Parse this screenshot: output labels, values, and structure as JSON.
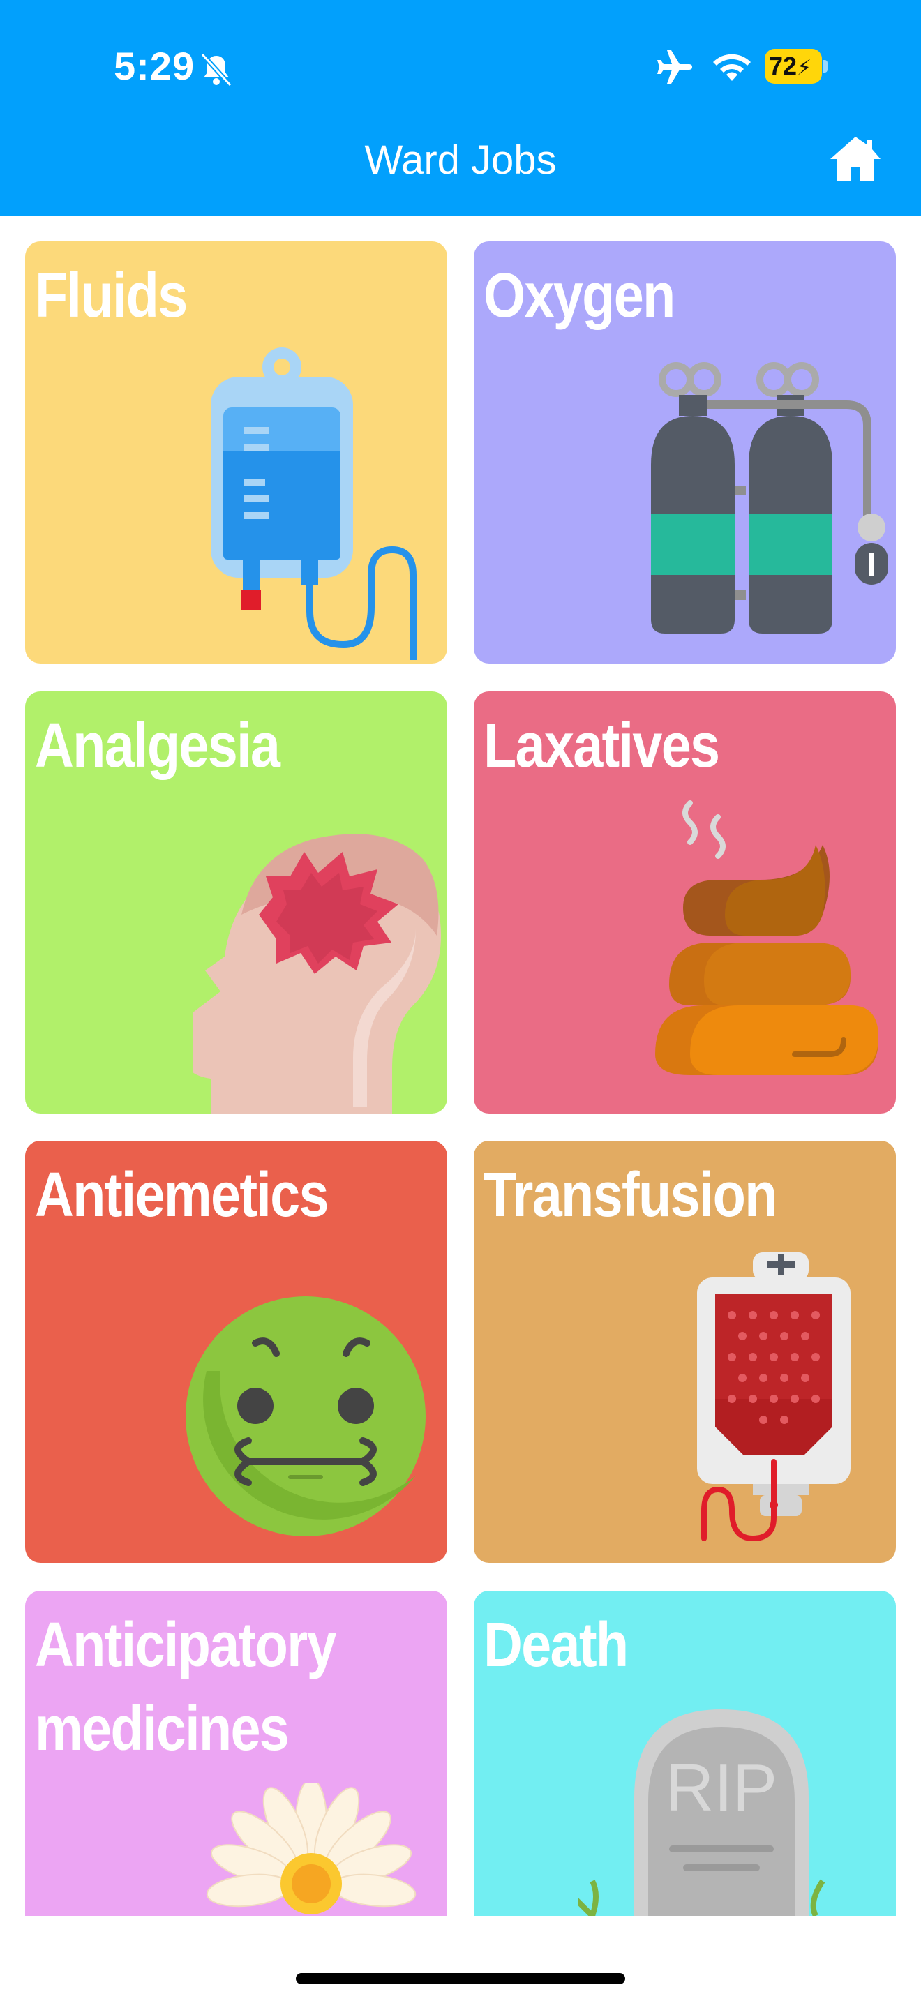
{
  "status_bar": {
    "time": "5:29",
    "battery_level": "72",
    "icons": [
      "bell-slash-icon",
      "airplane-icon",
      "wifi-icon",
      "battery-charging-icon"
    ]
  },
  "nav": {
    "title": "Ward Jobs",
    "home_icon": "home-icon"
  },
  "colors": {
    "header": "#02a0fc",
    "fluids": "#fcd97a",
    "oxygen": "#aca8fb",
    "analgesia": "#b1f06a",
    "laxatives": "#ea6c85",
    "antiemetics": "#ea604c",
    "transfusion": "#e2ab62",
    "anticipatory": "#eca5f3",
    "death": "#72eef2"
  },
  "tiles": [
    {
      "label": "Fluids",
      "icon": "iv-bag-icon"
    },
    {
      "label": "Oxygen",
      "icon": "oxygen-cylinders-icon"
    },
    {
      "label": "Analgesia",
      "icon": "headache-icon"
    },
    {
      "label": "Laxatives",
      "icon": "poop-icon"
    },
    {
      "label": "Antiemetics",
      "icon": "nauseous-face-icon"
    },
    {
      "label": "Transfusion",
      "icon": "blood-bag-icon"
    },
    {
      "label": "Anticipatory\nmedicines",
      "label_line1": "Anticipatory",
      "label_line2": "medicines",
      "icon": "flower-icon"
    },
    {
      "label": "Death",
      "icon": "gravestone-icon",
      "art_text": "RIP"
    }
  ]
}
